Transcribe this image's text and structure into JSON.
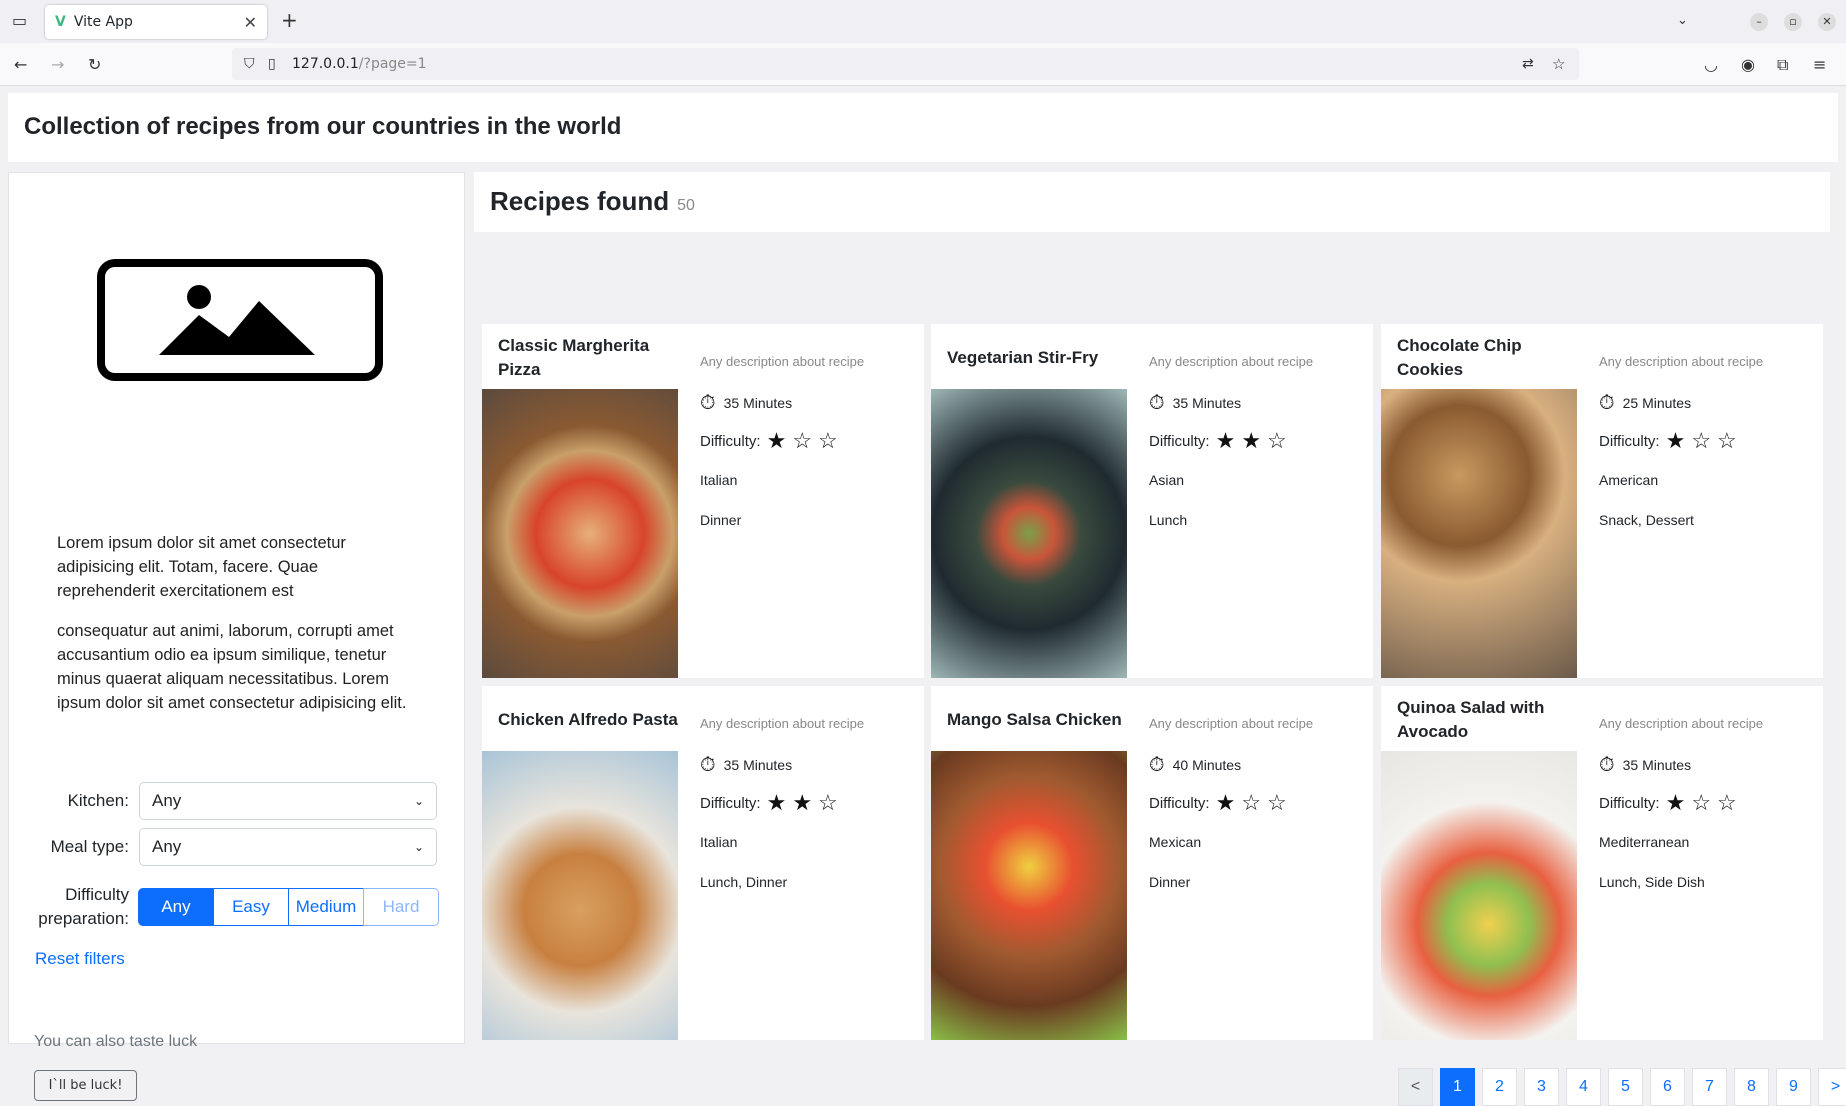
{
  "browser": {
    "tab_title": "Vite App",
    "url": "127.0.0.1/?page=1",
    "url_host": "127.0.0.1",
    "url_path": "/?page=1"
  },
  "header": {
    "title": "Collection of recipes from our countries in the world"
  },
  "sidebar": {
    "paragraph1": "Lorem ipsum dolor sit amet consectetur adipisicing elit. Totam, facere. Quae reprehenderit exercitationem est",
    "paragraph2": "consequatur aut animi, laborum, corrupti amet accusantium odio ea ipsum similique, tenetur minus quaerat aliquam necessitatibus. Lorem ipsum dolor sit amet consectetur adipisicing elit.",
    "kitchen_label": "Kitchen:",
    "kitchen_value": "Any",
    "meal_label": "Meal type:",
    "meal_value": "Any",
    "difficulty_label": "Difficulty preparation:",
    "difficulty_options": [
      "Any",
      "Easy",
      "Medium",
      "Hard"
    ],
    "reset_label": "Reset filters",
    "luck_text": "You can also taste luck",
    "luck_button": "I`ll be luck!"
  },
  "main": {
    "heading": "Recipes found",
    "count": "50",
    "recipes": [
      {
        "title": "Classic Margherita Pizza",
        "description": "Any description about recipe",
        "time": "35 Minutes",
        "difficulty_label": "Difficulty:",
        "difficulty": 1,
        "cuisine": "Italian",
        "meal": "Dinner"
      },
      {
        "title": "Vegetarian Stir-Fry",
        "description": "Any description about recipe",
        "time": "35 Minutes",
        "difficulty_label": "Difficulty:",
        "difficulty": 2,
        "cuisine": "Asian",
        "meal": "Lunch"
      },
      {
        "title": "Chocolate Chip Cookies",
        "description": "Any description about recipe",
        "time": "25 Minutes",
        "difficulty_label": "Difficulty:",
        "difficulty": 1,
        "cuisine": "American",
        "meal": "Snack, Dessert"
      },
      {
        "title": "Chicken Alfredo Pasta",
        "description": "Any description about recipe",
        "time": "35 Minutes",
        "difficulty_label": "Difficulty:",
        "difficulty": 2,
        "cuisine": "Italian",
        "meal": "Lunch, Dinner"
      },
      {
        "title": "Mango Salsa Chicken",
        "description": "Any description about recipe",
        "time": "40 Minutes",
        "difficulty_label": "Difficulty:",
        "difficulty": 1,
        "cuisine": "Mexican",
        "meal": "Dinner"
      },
      {
        "title": "Quinoa Salad with Avocado",
        "description": "Any description about recipe",
        "time": "35 Minutes",
        "difficulty_label": "Difficulty:",
        "difficulty": 1,
        "cuisine": "Mediterranean",
        "meal": "Lunch, Side Dish"
      }
    ]
  },
  "pagination": {
    "prev": "<",
    "next": ">",
    "pages": [
      "1",
      "2",
      "3",
      "4",
      "5",
      "6",
      "7",
      "8",
      "9"
    ],
    "current": "1"
  },
  "colors": {
    "accent": "#0d6efd"
  }
}
